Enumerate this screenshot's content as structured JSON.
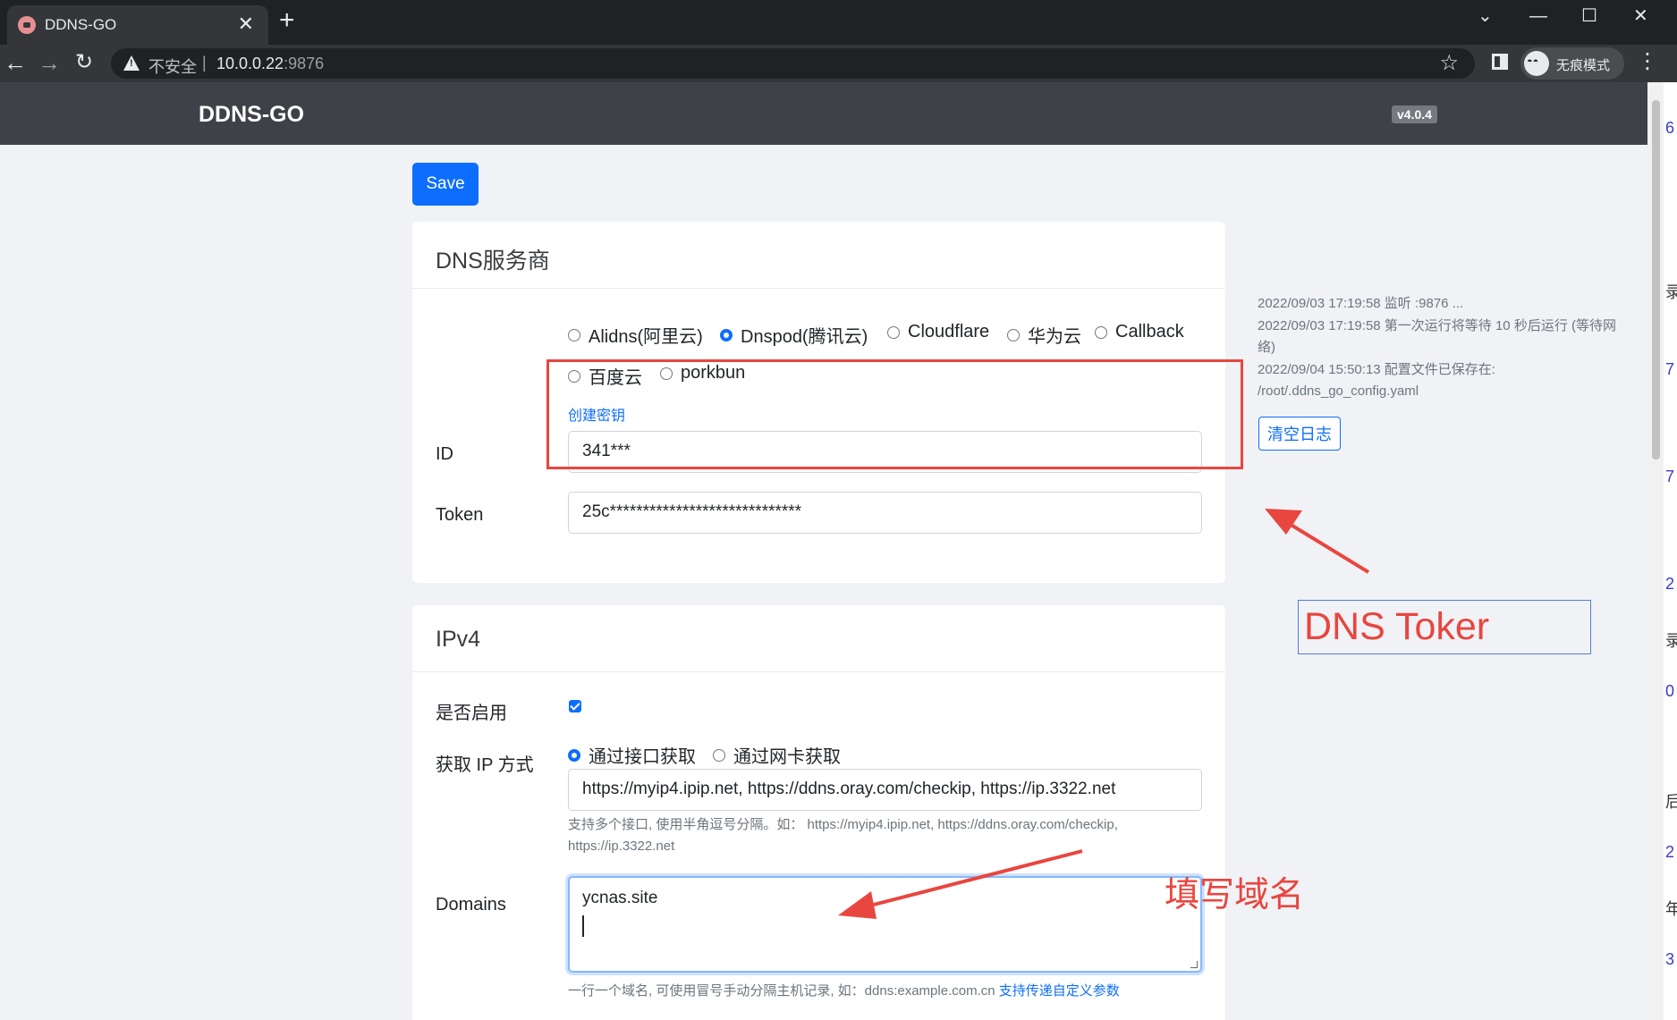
{
  "browser": {
    "tab_title": "DDNS-GO",
    "insecure_label": "不安全",
    "url_host": "10.0.0.22",
    "url_port": ":9876",
    "incognito_label": "无痕模式"
  },
  "app": {
    "brand": "DDNS-GO",
    "version": "v4.0.4",
    "save_label": "Save"
  },
  "dns_card": {
    "title": "DNS服务商",
    "providers": [
      "Alidns(阿里云)",
      "Dnspod(腾讯云)",
      "Cloudflare",
      "华为云",
      "Callback",
      "百度云",
      "porkbun"
    ],
    "selected_provider": "Dnspod(腾讯云)",
    "create_key_link": "创建密钥",
    "id_label": "ID",
    "id_value": "341***",
    "token_label": "Token",
    "token_value": "25c*****************************"
  },
  "ipv4_card": {
    "title": "IPv4",
    "enabled_label": "是否启用",
    "enabled": true,
    "ip_method_label": "获取 IP 方式",
    "ip_methods": [
      "通过接口获取",
      "通过网卡获取"
    ],
    "selected_method": "通过接口获取",
    "ip_urls": "https://myip4.ipip.net, https://ddns.oray.com/checkip, https://ip.3322.net",
    "ip_help_line1": "支持多个接口, 使用半角逗号分隔。如：  https://myip4.ipip.net, https://ddns.oray.com/checkip,",
    "ip_help_line2": "https://ip.3322.net",
    "domains_label": "Domains",
    "domains_value": "ycnas.site",
    "domains_help": "一行一个域名, 可使用冒号手动分隔主机记录, 如：ddns:example.com.cn",
    "domains_help_link": "支持传递自定义参数"
  },
  "log": {
    "lines": [
      "2022/09/03 17:19:58 监听 :9876 ...",
      "2022/09/03 17:19:58 第一次运行将等待 10 秒后运行 (等待网",
      "络)",
      "2022/09/04 15:50:13 配置文件已保存在:",
      "/root/.ddns_go_config.yaml"
    ],
    "clear_label": "清空日志"
  },
  "annotations": {
    "dns_token_note": "DNS Toker",
    "fill_domain_note": "填写域名",
    "color": "#e8463f"
  },
  "edge_chars": [
    "6",
    "录",
    "7",
    "7",
    "2",
    "录",
    "0",
    "后",
    "2",
    "年",
    "3"
  ]
}
